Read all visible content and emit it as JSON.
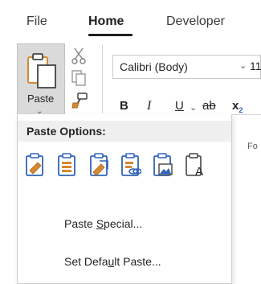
{
  "tabs": {
    "file": "File",
    "home": "Home",
    "developer": "Developer"
  },
  "clipboard": {
    "paste_label": "Paste",
    "paste_chevron": "⌄"
  },
  "font": {
    "name": "Calibri (Body)",
    "size": "11",
    "dropdown_chevron": "⌄"
  },
  "format": {
    "bold": "B",
    "italic": "I",
    "underline": "U",
    "underline_chevron": "⌄",
    "strikethrough": "ab",
    "subscript_x": "x",
    "subscript_2": "2",
    "group_label": "Fo"
  },
  "paste_options": {
    "title": "Paste Options:",
    "icons": [
      "keep-source-formatting-icon",
      "merge-formatting-icon",
      "use-destination-styles-icon",
      "link-and-keep-source-icon",
      "paste-as-picture-icon",
      "keep-text-only-icon"
    ],
    "paste_special_pre": "Paste ",
    "paste_special_acc": "S",
    "paste_special_post": "pecial...",
    "set_default_pre": "Set Defa",
    "set_default_acc": "u",
    "set_default_post": "lt Paste..."
  },
  "colors": {
    "accent_blue": "#2f64b8",
    "clipboard_orange": "#d6892f",
    "text": "#262626",
    "paste_button_bg": "#dadada",
    "header_bg": "#efefef"
  }
}
